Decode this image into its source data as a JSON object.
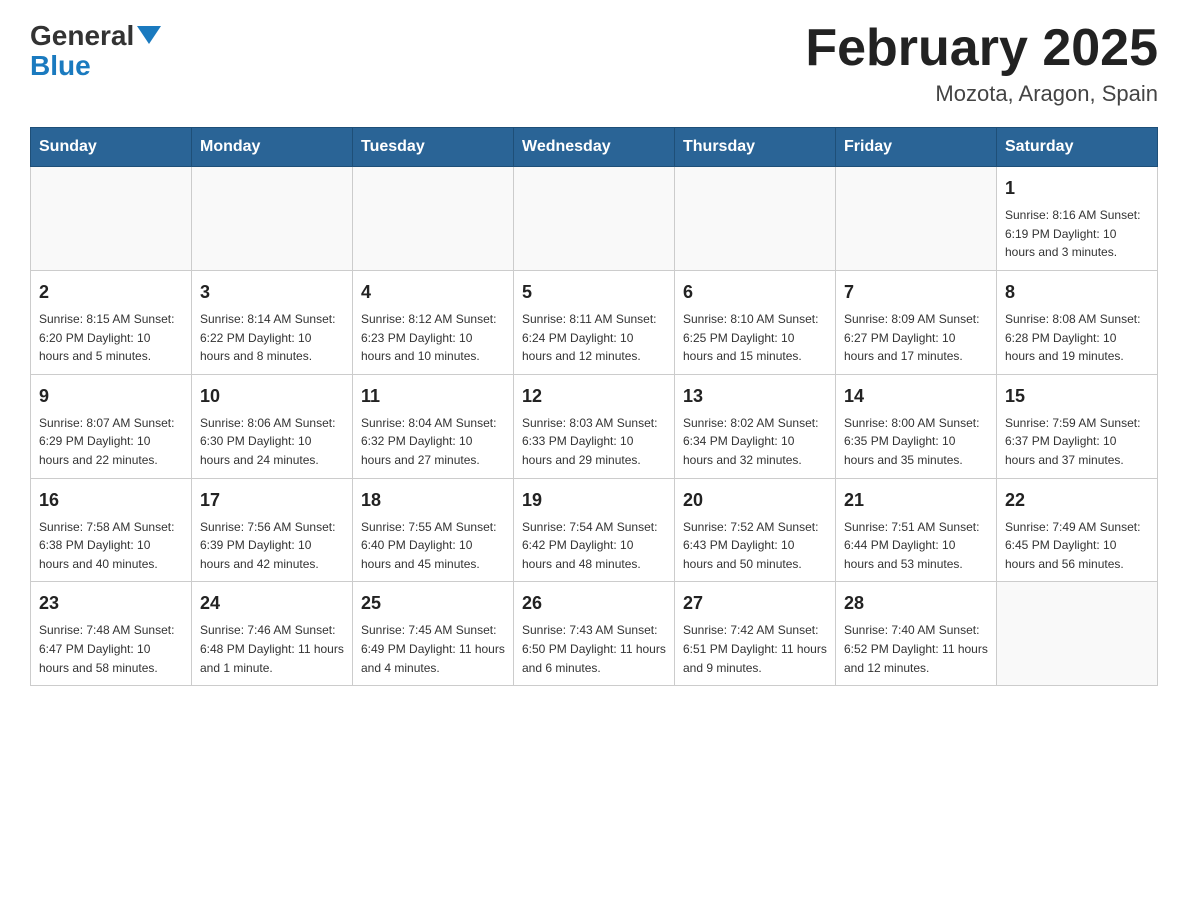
{
  "header": {
    "logo_general": "General",
    "logo_blue": "Blue",
    "title": "February 2025",
    "subtitle": "Mozota, Aragon, Spain"
  },
  "days_of_week": [
    "Sunday",
    "Monday",
    "Tuesday",
    "Wednesday",
    "Thursday",
    "Friday",
    "Saturday"
  ],
  "weeks": [
    [
      {
        "day": "",
        "info": ""
      },
      {
        "day": "",
        "info": ""
      },
      {
        "day": "",
        "info": ""
      },
      {
        "day": "",
        "info": ""
      },
      {
        "day": "",
        "info": ""
      },
      {
        "day": "",
        "info": ""
      },
      {
        "day": "1",
        "info": "Sunrise: 8:16 AM\nSunset: 6:19 PM\nDaylight: 10 hours and 3 minutes."
      }
    ],
    [
      {
        "day": "2",
        "info": "Sunrise: 8:15 AM\nSunset: 6:20 PM\nDaylight: 10 hours and 5 minutes."
      },
      {
        "day": "3",
        "info": "Sunrise: 8:14 AM\nSunset: 6:22 PM\nDaylight: 10 hours and 8 minutes."
      },
      {
        "day": "4",
        "info": "Sunrise: 8:12 AM\nSunset: 6:23 PM\nDaylight: 10 hours and 10 minutes."
      },
      {
        "day": "5",
        "info": "Sunrise: 8:11 AM\nSunset: 6:24 PM\nDaylight: 10 hours and 12 minutes."
      },
      {
        "day": "6",
        "info": "Sunrise: 8:10 AM\nSunset: 6:25 PM\nDaylight: 10 hours and 15 minutes."
      },
      {
        "day": "7",
        "info": "Sunrise: 8:09 AM\nSunset: 6:27 PM\nDaylight: 10 hours and 17 minutes."
      },
      {
        "day": "8",
        "info": "Sunrise: 8:08 AM\nSunset: 6:28 PM\nDaylight: 10 hours and 19 minutes."
      }
    ],
    [
      {
        "day": "9",
        "info": "Sunrise: 8:07 AM\nSunset: 6:29 PM\nDaylight: 10 hours and 22 minutes."
      },
      {
        "day": "10",
        "info": "Sunrise: 8:06 AM\nSunset: 6:30 PM\nDaylight: 10 hours and 24 minutes."
      },
      {
        "day": "11",
        "info": "Sunrise: 8:04 AM\nSunset: 6:32 PM\nDaylight: 10 hours and 27 minutes."
      },
      {
        "day": "12",
        "info": "Sunrise: 8:03 AM\nSunset: 6:33 PM\nDaylight: 10 hours and 29 minutes."
      },
      {
        "day": "13",
        "info": "Sunrise: 8:02 AM\nSunset: 6:34 PM\nDaylight: 10 hours and 32 minutes."
      },
      {
        "day": "14",
        "info": "Sunrise: 8:00 AM\nSunset: 6:35 PM\nDaylight: 10 hours and 35 minutes."
      },
      {
        "day": "15",
        "info": "Sunrise: 7:59 AM\nSunset: 6:37 PM\nDaylight: 10 hours and 37 minutes."
      }
    ],
    [
      {
        "day": "16",
        "info": "Sunrise: 7:58 AM\nSunset: 6:38 PM\nDaylight: 10 hours and 40 minutes."
      },
      {
        "day": "17",
        "info": "Sunrise: 7:56 AM\nSunset: 6:39 PM\nDaylight: 10 hours and 42 minutes."
      },
      {
        "day": "18",
        "info": "Sunrise: 7:55 AM\nSunset: 6:40 PM\nDaylight: 10 hours and 45 minutes."
      },
      {
        "day": "19",
        "info": "Sunrise: 7:54 AM\nSunset: 6:42 PM\nDaylight: 10 hours and 48 minutes."
      },
      {
        "day": "20",
        "info": "Sunrise: 7:52 AM\nSunset: 6:43 PM\nDaylight: 10 hours and 50 minutes."
      },
      {
        "day": "21",
        "info": "Sunrise: 7:51 AM\nSunset: 6:44 PM\nDaylight: 10 hours and 53 minutes."
      },
      {
        "day": "22",
        "info": "Sunrise: 7:49 AM\nSunset: 6:45 PM\nDaylight: 10 hours and 56 minutes."
      }
    ],
    [
      {
        "day": "23",
        "info": "Sunrise: 7:48 AM\nSunset: 6:47 PM\nDaylight: 10 hours and 58 minutes."
      },
      {
        "day": "24",
        "info": "Sunrise: 7:46 AM\nSunset: 6:48 PM\nDaylight: 11 hours and 1 minute."
      },
      {
        "day": "25",
        "info": "Sunrise: 7:45 AM\nSunset: 6:49 PM\nDaylight: 11 hours and 4 minutes."
      },
      {
        "day": "26",
        "info": "Sunrise: 7:43 AM\nSunset: 6:50 PM\nDaylight: 11 hours and 6 minutes."
      },
      {
        "day": "27",
        "info": "Sunrise: 7:42 AM\nSunset: 6:51 PM\nDaylight: 11 hours and 9 minutes."
      },
      {
        "day": "28",
        "info": "Sunrise: 7:40 AM\nSunset: 6:52 PM\nDaylight: 11 hours and 12 minutes."
      },
      {
        "day": "",
        "info": ""
      }
    ]
  ]
}
